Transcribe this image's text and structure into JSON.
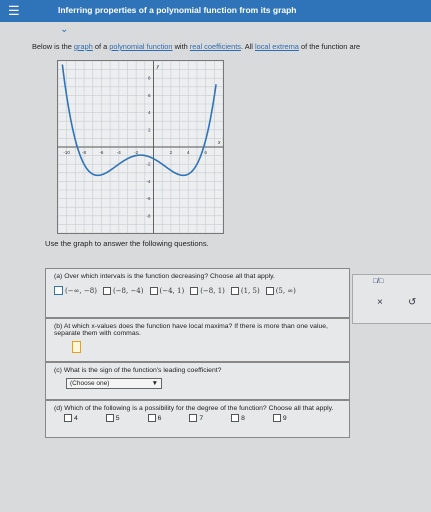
{
  "header": {
    "menu_icon": "hamburger-menu-icon",
    "title": "Inferring properties of a polynomial function from its graph",
    "collapse_icon": "chevron-down-icon"
  },
  "intro": {
    "prefix": "Below is the ",
    "link1": "graph",
    "mid1": " of a ",
    "link2": "polynomial function",
    "mid2": " with ",
    "link3": "real coefficients",
    "mid3": ". All ",
    "link4": "local extrema",
    "suffix": " of the function are"
  },
  "graph": {
    "x_ticks": [
      "-10",
      "-8",
      "-6",
      "-4",
      "-2",
      "2",
      "4",
      "6"
    ],
    "y_ticks": [
      "8",
      "6",
      "4",
      "2",
      "-2",
      "-4",
      "-6",
      "-8"
    ],
    "x_label": "x",
    "y_label": "y",
    "curve_color": "#2f74b8"
  },
  "use_text": "Use the graph to answer the following questions.",
  "question_a": {
    "text": "(a) Over which intervals is the function decreasing? Choose all that apply.",
    "options": [
      "(−∞, −8)",
      "(−8, −4)",
      "(−4, 1)",
      "(−8, 1)",
      "(1, 5)",
      "(5, ∞)"
    ]
  },
  "question_b": {
    "text": "(b) At which x-values does the function have local maxima? If there is more than one value, separate them with commas."
  },
  "question_c": {
    "text": "(c) What is the sign of the function's leading coefficient?",
    "select_value": "(Choose one)"
  },
  "question_d": {
    "text": "(d) Which of the following is a possibility for the degree of the function? Choose all that apply.",
    "options": [
      "4",
      "5",
      "6",
      "7",
      "8",
      "9"
    ]
  },
  "side_tools": {
    "fraction_icon": "fraction-icon",
    "fraction_glyph": "□/□",
    "clear_glyph": "×",
    "undo_glyph": "↺"
  }
}
